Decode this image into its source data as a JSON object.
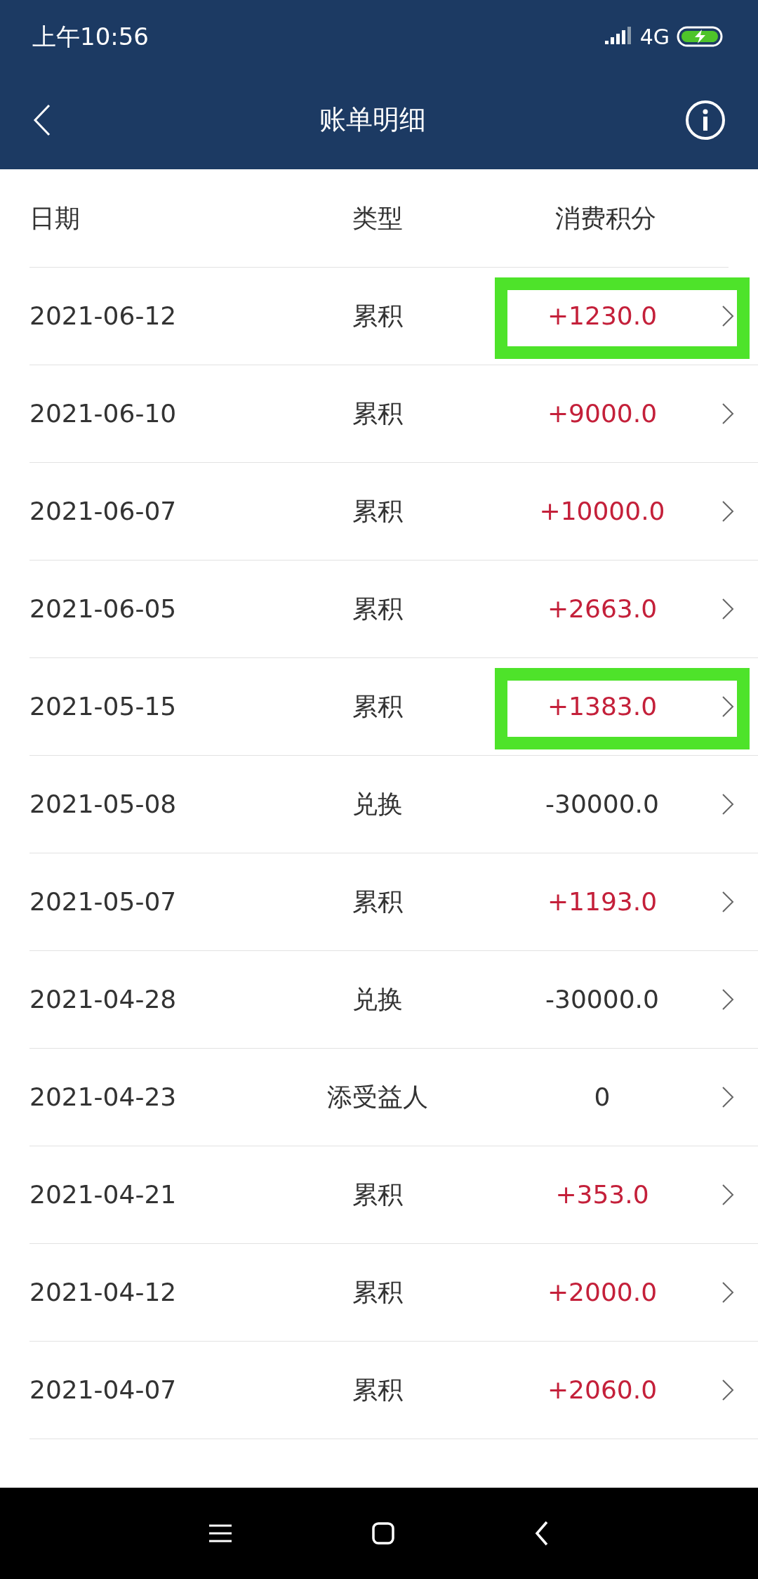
{
  "status_bar": {
    "time": "上午10:56",
    "network": "4G"
  },
  "header": {
    "title": "账单明细"
  },
  "table": {
    "columns": [
      "日期",
      "类型",
      "消费积分"
    ],
    "rows": [
      {
        "date": "2021-06-12",
        "type": "累积",
        "points": "+1230.0",
        "kind": "credit",
        "highlighted": true
      },
      {
        "date": "2021-06-10",
        "type": "累积",
        "points": "+9000.0",
        "kind": "credit",
        "highlighted": false
      },
      {
        "date": "2021-06-07",
        "type": "累积",
        "points": "+10000.0",
        "kind": "credit",
        "highlighted": false
      },
      {
        "date": "2021-06-05",
        "type": "累积",
        "points": "+2663.0",
        "kind": "credit",
        "highlighted": false
      },
      {
        "date": "2021-05-15",
        "type": "累积",
        "points": "+1383.0",
        "kind": "credit",
        "highlighted": true
      },
      {
        "date": "2021-05-08",
        "type": "兑换",
        "points": "-30000.0",
        "kind": "debit",
        "highlighted": false
      },
      {
        "date": "2021-05-07",
        "type": "累积",
        "points": "+1193.0",
        "kind": "credit",
        "highlighted": false
      },
      {
        "date": "2021-04-28",
        "type": "兑换",
        "points": "-30000.0",
        "kind": "debit",
        "highlighted": false
      },
      {
        "date": "2021-04-23",
        "type": "添受益人",
        "points": "0",
        "kind": "debit",
        "highlighted": false
      },
      {
        "date": "2021-04-21",
        "type": "累积",
        "points": "+353.0",
        "kind": "credit",
        "highlighted": false
      },
      {
        "date": "2021-04-12",
        "type": "累积",
        "points": "+2000.0",
        "kind": "credit",
        "highlighted": false
      },
      {
        "date": "2021-04-07",
        "type": "累积",
        "points": "+2060.0",
        "kind": "credit",
        "highlighted": false
      }
    ]
  }
}
